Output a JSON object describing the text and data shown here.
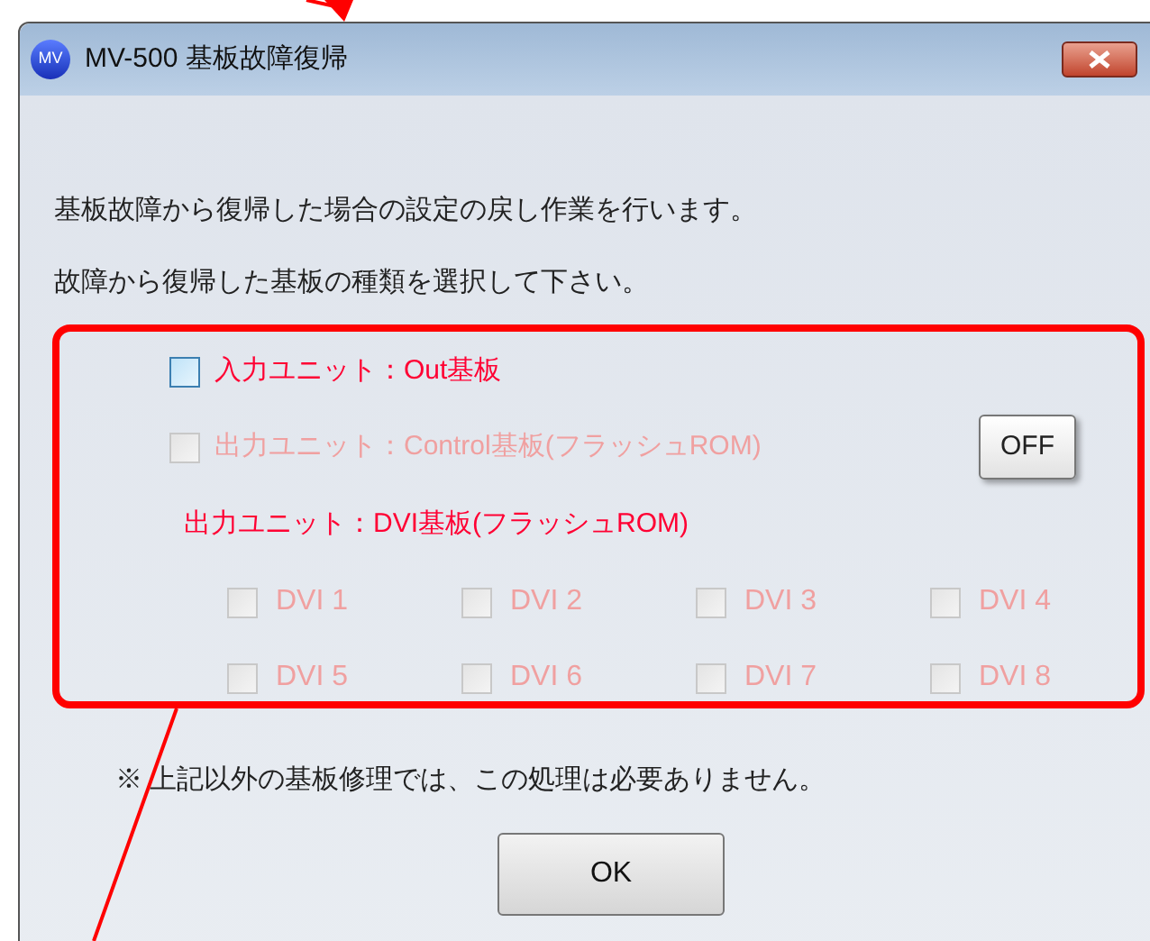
{
  "window": {
    "title": "MV-500 基板故障復帰",
    "icon_text": "MV"
  },
  "intro": [
    "基板故障から復帰した場合の設定の戻し作業を行います。",
    "故障から復帰した基板の種類を選択して下さい。"
  ],
  "options": [
    {
      "kind": "checkbox",
      "label": "入力ユニット：Out基板",
      "checked": false,
      "disabled": false
    },
    {
      "kind": "checkbox",
      "label": "出力ユニット：Control基板(フラッシュROM)",
      "checked": false,
      "disabled": true,
      "toggle": "OFF"
    },
    {
      "kind": "heading",
      "label": "出力ユニット：DVI基板(フラッシュROM)"
    }
  ],
  "dvi": [
    {
      "label": "DVI 1",
      "checked": false,
      "disabled": true
    },
    {
      "label": "DVI 2",
      "checked": false,
      "disabled": true
    },
    {
      "label": "DVI 3",
      "checked": false,
      "disabled": true
    },
    {
      "label": "DVI 4",
      "checked": false,
      "disabled": true
    },
    {
      "label": "DVI 5",
      "checked": false,
      "disabled": true
    },
    {
      "label": "DVI 6",
      "checked": false,
      "disabled": true
    },
    {
      "label": "DVI 7",
      "checked": false,
      "disabled": true
    },
    {
      "label": "DVI 8",
      "checked": false,
      "disabled": true
    }
  ],
  "note": "※ 上記以外の基板修理では、この処理は必要ありません。",
  "buttons": [
    "OK"
  ]
}
